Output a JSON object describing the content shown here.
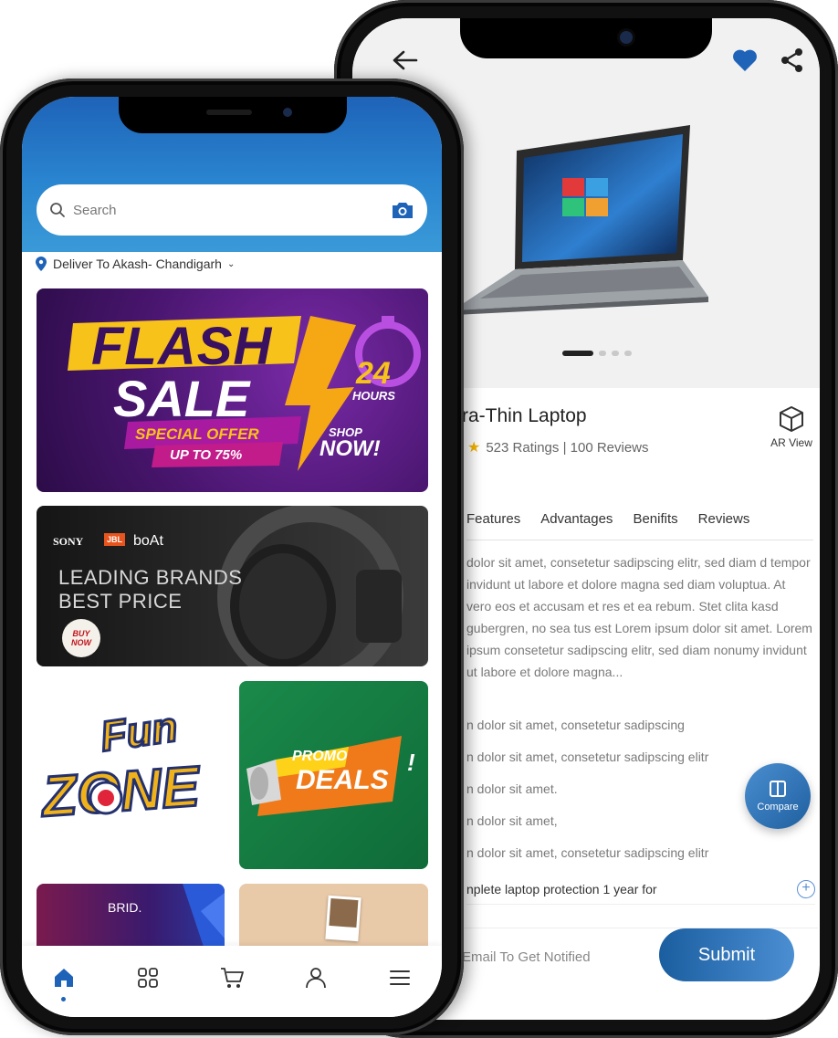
{
  "back_phone": {
    "product": {
      "title": "ra-Thin Laptop",
      "ratings_text": "523 Ratings | 100 Reviews",
      "ar_view_label": "AR View"
    },
    "tabs": [
      "Features",
      "Advantages",
      "Benifits",
      "Reviews"
    ],
    "description": "dolor sit amet, consetetur sadipscing elitr, sed diam d tempor invidunt ut labore et dolore magna sed diam voluptua. At vero eos et accusam et res et ea rebum. Stet clita kasd gubergren, no sea tus est Lorem ipsum dolor sit amet. Lorem ipsum consetetur sadipscing elitr, sed diam nonumy invidunt ut labore et dolore magna...",
    "bullets": [
      "n dolor sit amet, consetetur sadipscing",
      "n dolor sit amet, consetetur sadipscing elitr",
      "n dolor sit amet.",
      "n dolor sit amet,",
      "n dolor sit amet, consetetur sadipscing elitr"
    ],
    "protection_text": "nplete laptop protection 1 year for",
    "compare_label": "Compare",
    "notify": {
      "placeholder": "Email To Get Notified",
      "submit_label": "Submit"
    },
    "colors": {
      "accent": "#1e63b8",
      "heart": "#1e63b8"
    }
  },
  "front_phone": {
    "search_placeholder": "Search",
    "deliver_text": "Deliver To Akash- Chandigarh",
    "banners": {
      "flash": {
        "line1": "FLASH",
        "line2": "SALE",
        "offer": "SPECIAL OFFER",
        "upto": "UP TO 75%",
        "hours_num": "24",
        "hours_label": "HOURS",
        "shop": "SHOP",
        "now": "NOW!"
      },
      "brands": {
        "sony": "SONY",
        "jbl": "JBL",
        "boat": "boAt",
        "line1": "LEADING BRANDS",
        "line2": "BEST PRICE",
        "buy": "BUY",
        "now": "NOW"
      },
      "fun": {
        "line1": "Fun",
        "line2": "ZONE"
      },
      "promo": {
        "line1": "PROMO",
        "line2": "DEALS"
      },
      "brid": {
        "label": "BRID."
      }
    },
    "nav": [
      "home-icon",
      "grid-icon",
      "cart-icon",
      "user-icon",
      "menu-icon"
    ]
  }
}
